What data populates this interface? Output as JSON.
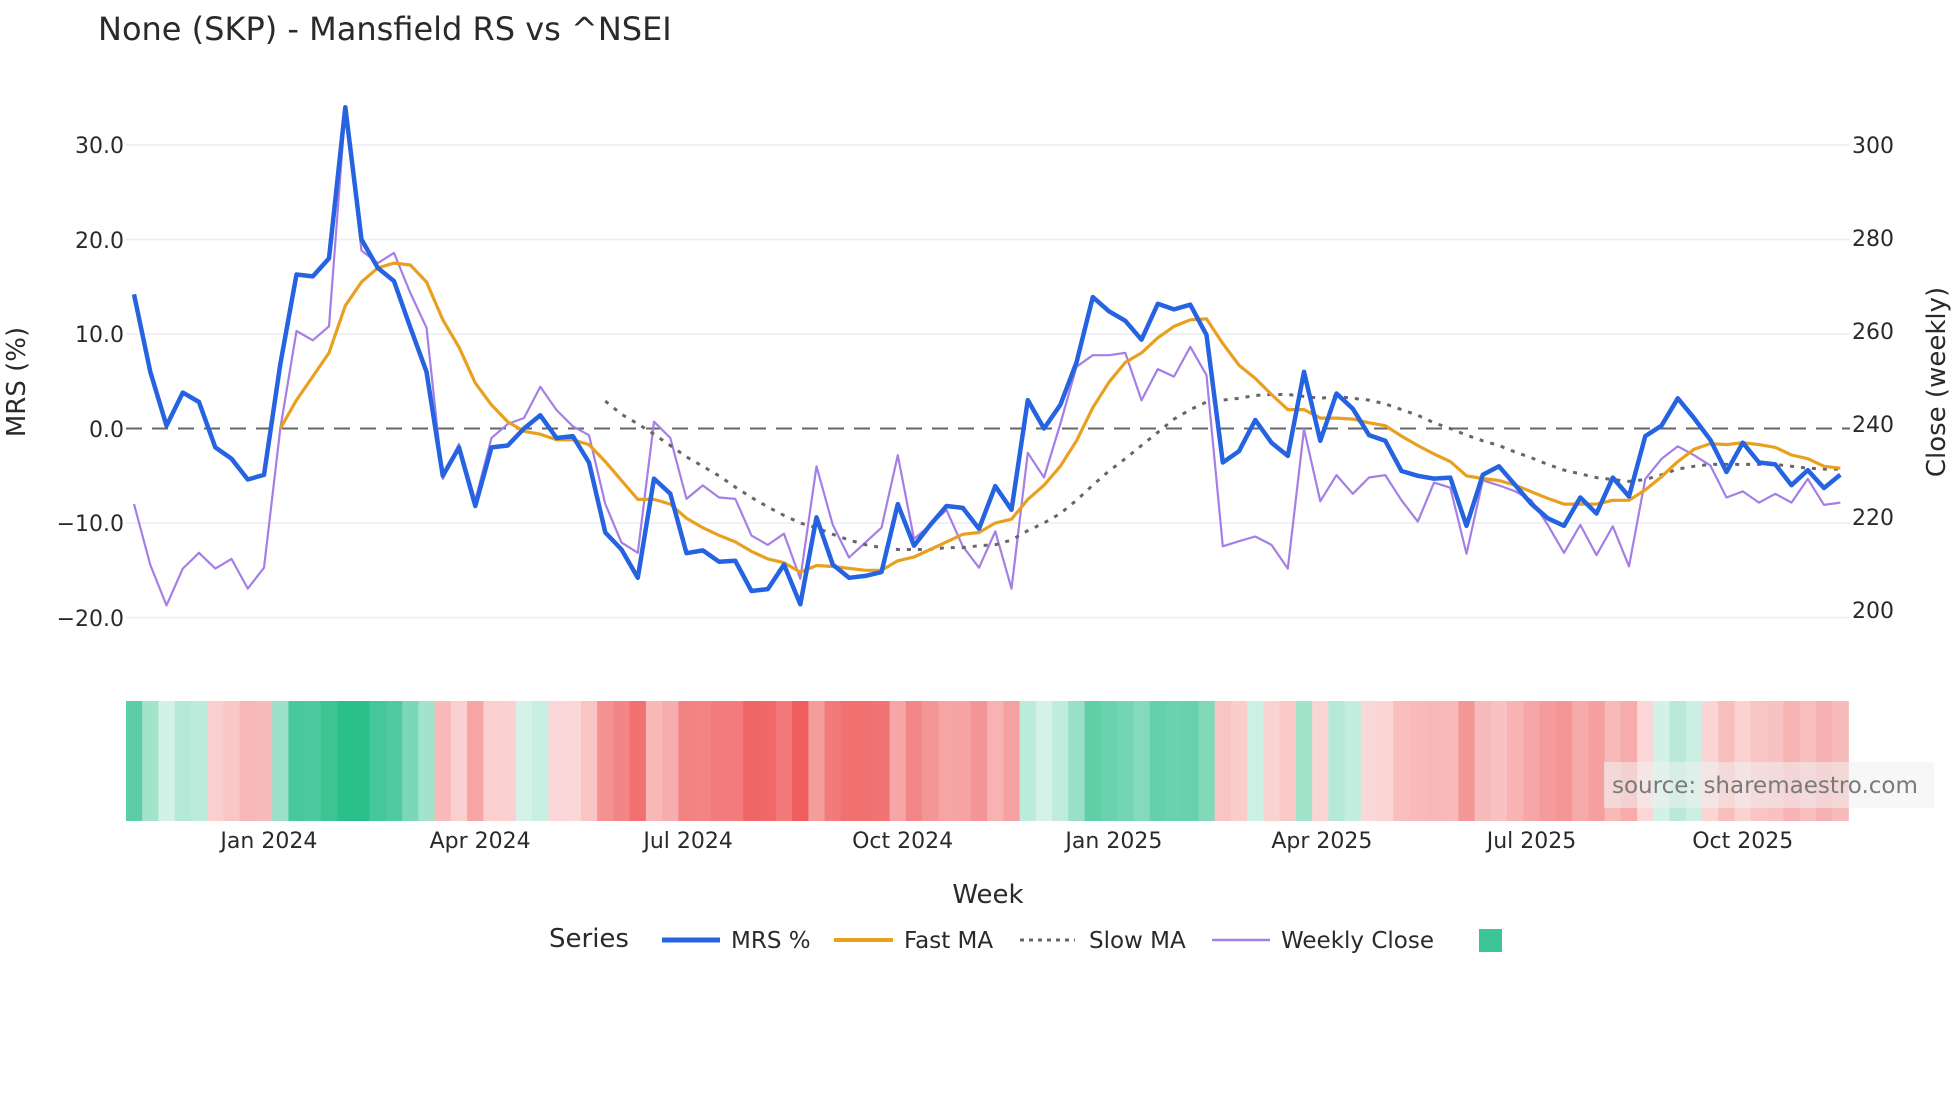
{
  "chart_data": {
    "type": "line",
    "title": "None (SKP) - Mansfield RS vs ^NSEI",
    "xlabel": "Week",
    "ylabel": "MRS (%)",
    "y2label": "Close (weekly)",
    "ylim": [
      -20,
      30
    ],
    "y2lim": [
      200,
      300
    ],
    "yticks": [
      "30.0",
      "20.0",
      "10.0",
      "0.0",
      "−10.0",
      "−20.0"
    ],
    "y2ticks": [
      "300",
      "280",
      "260",
      "240",
      "220",
      "200"
    ],
    "xticks": [
      {
        "label": "Jan 2024",
        "week_index": 8.3
      },
      {
        "label": "Apr 2024",
        "week_index": 21.3
      },
      {
        "label": "Jul 2024",
        "week_index": 34.1
      },
      {
        "label": "Oct 2024",
        "week_index": 47.3
      },
      {
        "label": "Jan 2025",
        "week_index": 60.3
      },
      {
        "label": "Apr 2025",
        "week_index": 73.1
      },
      {
        "label": "Jul 2025",
        "week_index": 86.0
      },
      {
        "label": "Oct 2025",
        "week_index": 99.0
      }
    ],
    "reference_line": 0,
    "legend_title": "Series",
    "legend_placement": "bottom-center",
    "series": [
      {
        "name": "MRS %",
        "axis": "left",
        "color": "#2563e0",
        "values": [
          14.2,
          6,
          0.3,
          3.8,
          2.8,
          -2,
          -3.2,
          -5.4,
          -4.9,
          6.8,
          16.3,
          16.1,
          18,
          34,
          20,
          17,
          15.6,
          10.7,
          6,
          -5,
          -2,
          -8.2,
          -2,
          -1.8,
          0,
          1.4,
          -1,
          -0.8,
          -3.6,
          -11,
          -12.8,
          -15.8,
          -5.3,
          -6.9,
          -13.2,
          -12.9,
          -14.1,
          -14,
          -17.2,
          -17,
          -14.4,
          -18.6,
          -9.4,
          -14.4,
          -15.8,
          -15.6,
          -15.2,
          -8,
          -12.4,
          -10.2,
          -8.2,
          -8.4,
          -10.6,
          -6.1,
          -8.6,
          3,
          0,
          2.5,
          7,
          13.9,
          12.4,
          11.4,
          9.4,
          13.2,
          12.6,
          13.1,
          9.9,
          -3.6,
          -2.4,
          0.9,
          -1.5,
          -2.9,
          6,
          -1.3,
          3.7,
          2.1,
          -0.7,
          -1.3,
          -4.5,
          -5,
          -5.3,
          -5.2,
          -10.3,
          -4.9,
          -4,
          -6,
          -8,
          -9.5,
          -10.3,
          -7.3,
          -9,
          -5.2,
          -7.2,
          -0.8,
          0.3,
          3.2,
          1.1,
          -1.2,
          -4.6,
          -1.5,
          -3.6,
          -3.8,
          -6,
          -4.4,
          -6.3,
          -4.9
        ]
      },
      {
        "name": "Fast MA",
        "axis": "left",
        "color": "#e9a020",
        "values": [
          0,
          3,
          5.5,
          8,
          13,
          15.5,
          17,
          17.5,
          17.3,
          15.5,
          11.5,
          8.6,
          4.8,
          2.5,
          0.7,
          -0.3,
          -0.6,
          -1.2,
          -1.2,
          -1.7,
          -3.5,
          -5.5,
          -7.5,
          -7.5,
          -8,
          -9.5,
          -10.5,
          -11.3,
          -12,
          -13,
          -13.8,
          -14.2,
          -15.2,
          -14.5,
          -14.6,
          -14.8,
          -15,
          -15,
          -14,
          -13.6,
          -12.8,
          -12,
          -11.2,
          -11,
          -10,
          -9.6,
          -7.5,
          -6,
          -4,
          -1.3,
          2.2,
          4.9,
          7,
          8,
          9.6,
          10.8,
          11.5,
          11.6,
          9,
          6.7,
          5.3,
          3.6,
          2,
          2,
          1.1,
          1.1,
          1,
          0.6,
          0.3,
          -0.8,
          -1.8,
          -2.7,
          -3.5,
          -5,
          -5.3,
          -5.5,
          -6,
          -6.7,
          -7.4,
          -8,
          -8,
          -8,
          -7.6,
          -7.6,
          -6.5,
          -5.1,
          -3.5,
          -2.2,
          -1.6,
          -1.7,
          -1.5,
          -1.7,
          -2,
          -2.8,
          -3.2,
          -4,
          -4.2
        ]
      },
      {
        "name": "Slow MA",
        "axis": "left",
        "color": "#666666",
        "values": [
          2.9,
          1.5,
          0.5,
          -0.6,
          -1.8,
          -3,
          -4,
          -5,
          -6.2,
          -7.3,
          -8.3,
          -9.2,
          -10,
          -10.5,
          -11.2,
          -11.8,
          -12.3,
          -12.6,
          -12.8,
          -12.8,
          -12.8,
          -12.6,
          -12.6,
          -12.4,
          -12.3,
          -11.8,
          -10.8,
          -10,
          -9,
          -7.6,
          -6,
          -4.5,
          -3.2,
          -1.8,
          -0.4,
          1,
          2,
          2.8,
          3,
          3.2,
          3.5,
          3.6,
          3.6,
          3.4,
          3.2,
          3.4,
          3.2,
          3,
          2.6,
          2,
          1.4,
          0.6,
          0,
          -0.7,
          -1.3,
          -1.8,
          -2.5,
          -3.1,
          -3.8,
          -4.4,
          -4.8,
          -5.2,
          -5.4,
          -5.6,
          -5.4,
          -4.9,
          -4.3,
          -4,
          -3.8,
          -3.8,
          -3.8,
          -3.8,
          -3.8,
          -4,
          -4.2,
          -4.3,
          -4.3
        ]
      },
      {
        "name": "Weekly Close",
        "axis": "right",
        "color": "#a57ee6",
        "values": [
          222.8,
          209.7,
          201,
          208.9,
          212.3,
          208.9,
          211,
          204.6,
          209.1,
          239,
          260,
          258,
          261,
          307.6,
          277.3,
          274.6,
          276.8,
          268.2,
          260.7,
          228.2,
          235.7,
          223.6,
          237,
          240,
          241.3,
          248,
          243,
          239.5,
          237.6,
          222.8,
          214.5,
          212.3,
          240.5,
          237,
          223.9,
          226.8,
          224.2,
          223.9,
          216,
          214,
          216.4,
          206.7,
          230.9,
          218.3,
          211.3,
          214.5,
          217.7,
          233.3,
          215.3,
          218.3,
          221.5,
          213.7,
          209.1,
          216.9,
          204.6,
          233.8,
          228.5,
          240,
          252.3,
          254.8,
          254.8,
          255.3,
          245.1,
          251.8,
          250.2,
          256.6,
          250.5,
          213.7,
          214.8,
          215.8,
          214,
          208.9,
          238.9,
          223.4,
          229,
          225,
          228.5,
          229,
          223.6,
          219,
          227.4,
          226.3,
          212.1,
          227.9,
          226.8,
          225.5,
          223.6,
          218.3,
          212.3,
          218.3,
          211.8,
          218,
          209.4,
          228.2,
          232.5,
          235.2,
          233.3,
          231.1,
          224.2,
          225.5,
          223.1,
          225,
          223.1,
          228.2,
          222.6,
          223.1
        ]
      }
    ],
    "heatmap": {
      "based_on": "MRS %",
      "positive_color": "#2bbf8c",
      "negative_color": "#ee5353",
      "range": [
        -20,
        20
      ]
    },
    "watermark": "source: sharemaestro.com"
  }
}
